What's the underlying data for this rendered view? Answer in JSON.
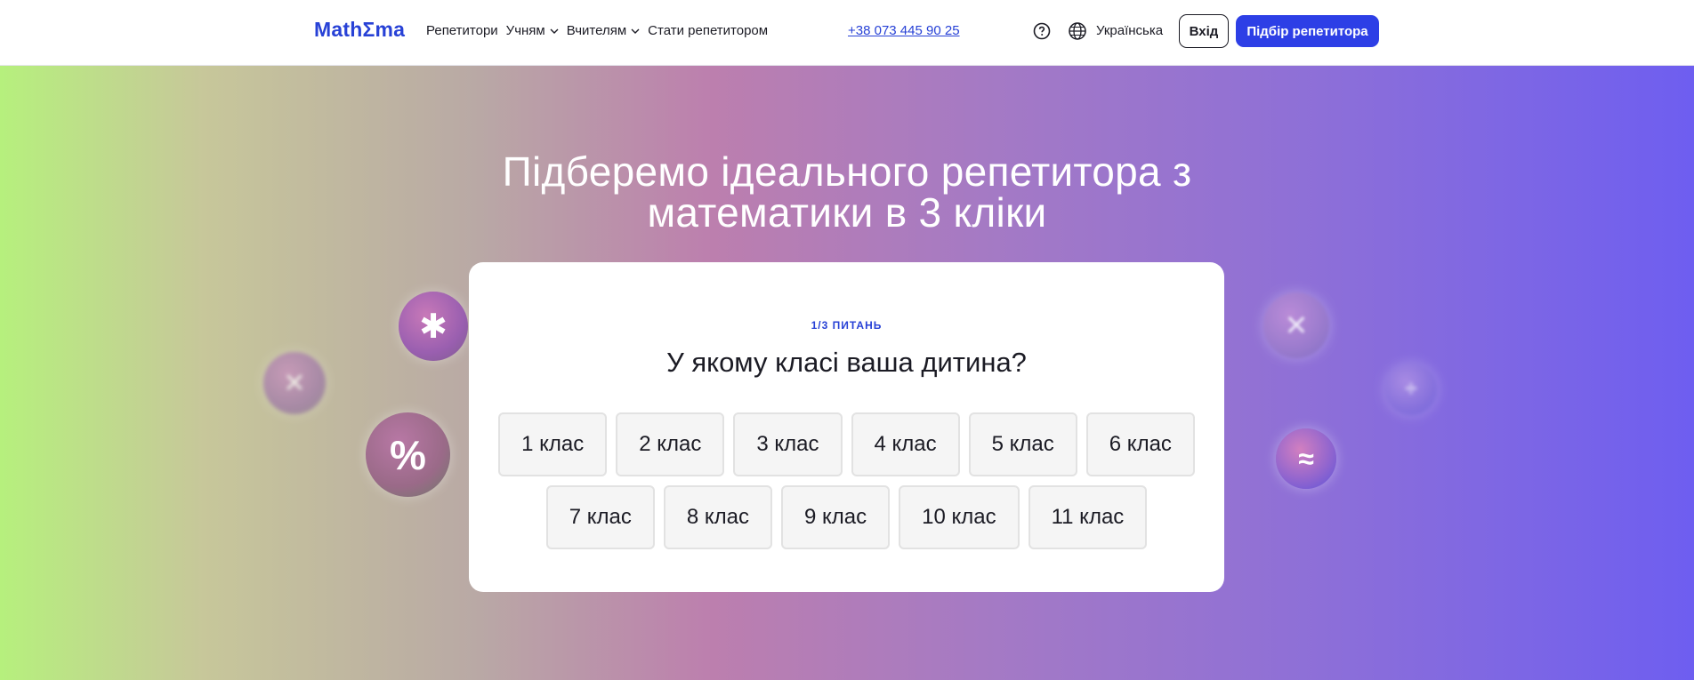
{
  "header": {
    "logo": "MathΣma",
    "nav": [
      {
        "label": "Репетитори",
        "dropdown": false
      },
      {
        "label": "Учням",
        "dropdown": true
      },
      {
        "label": "Вчителям",
        "dropdown": true
      },
      {
        "label": "Стати репетитором",
        "dropdown": false
      }
    ],
    "phone": "+38 073 445 90 25",
    "language": "Українська",
    "login_label": "Вхід",
    "match_label": "Підбір репетитора"
  },
  "hero": {
    "title_line1": "Підберемо ідеального репетитора з",
    "title_line2": "математики в 3 кліки",
    "bubbles": [
      "✱",
      "%",
      "✕",
      "✕",
      "≈",
      "÷"
    ]
  },
  "quiz": {
    "step": "1/3 ПИТАНЬ",
    "question": "У якому класі ваша дитина?",
    "grades_row1": [
      "1 клас",
      "2 клас",
      "3 клас",
      "4 клас",
      "5 клас",
      "6 клас"
    ],
    "grades_row2": [
      "7 клас",
      "8 клас",
      "9 клас",
      "10 клас",
      "11 клас"
    ]
  },
  "colors": {
    "brand": "#2741d6",
    "cta": "#2d3fe6",
    "text": "#1b1b24"
  }
}
